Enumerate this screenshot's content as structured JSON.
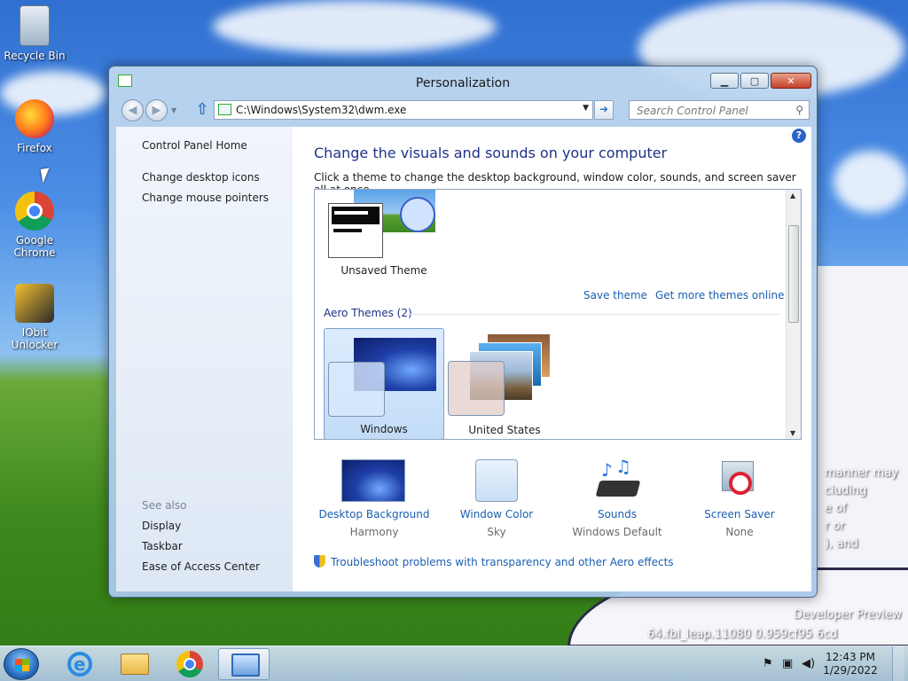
{
  "desktop": {
    "icons": [
      {
        "label": "Recycle Bin"
      },
      {
        "label": "Firefox"
      },
      {
        "label": "Google Chrome"
      },
      {
        "label": "IObit Unlocker"
      }
    ],
    "watermark": {
      "line1": "manner may",
      "line2": "cluding",
      "line3": "e of",
      "line4": "r or",
      "line5": "), and",
      "line6": "Developer Preview",
      "line7": "64.fbl_leap.11080    0.959cf95    6cd"
    }
  },
  "window": {
    "title": "Personalization",
    "address": "C:\\Windows\\System32\\dwm.exe",
    "search_placeholder": "Search Control Panel",
    "left_pane": {
      "home": "Control Panel Home",
      "links": [
        "Change desktop icons",
        "Change mouse pointers"
      ],
      "see_also": "See also",
      "see_also_links": [
        "Display",
        "Taskbar",
        "Ease of Access Center"
      ]
    },
    "heading": "Change the visuals and sounds on your computer",
    "subheading": "Click a theme to change the desktop background, window color, sounds, and screen saver all at once.",
    "unsaved_theme": "Unsaved Theme",
    "save_theme": "Save theme",
    "more_themes": "Get more themes online",
    "aero_group": "Aero Themes (2)",
    "themes": [
      "Windows",
      "United States"
    ],
    "settings": [
      {
        "title": "Desktop Background",
        "value": "Harmony"
      },
      {
        "title": "Window Color",
        "value": "Sky"
      },
      {
        "title": "Sounds",
        "value": "Windows Default"
      },
      {
        "title": "Screen Saver",
        "value": "None"
      }
    ],
    "troubleshoot": "Troubleshoot problems with transparency and other Aero effects"
  },
  "taskbar": {
    "time": "12:43 PM",
    "date": "1/29/2022"
  }
}
